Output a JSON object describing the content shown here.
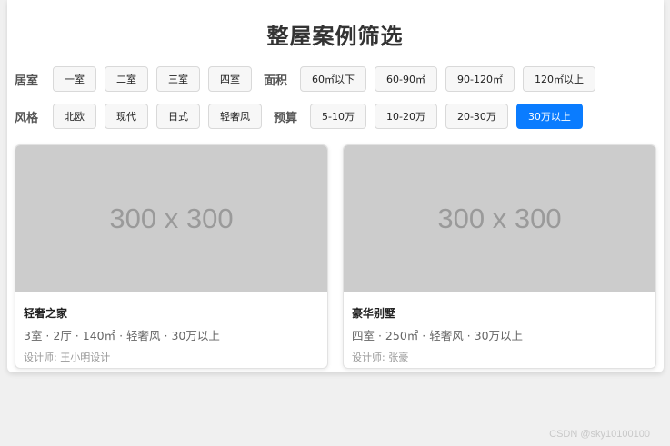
{
  "page": {
    "title": "整屋案例筛选"
  },
  "filters": {
    "layout": {
      "label": "居室",
      "options": [
        "一室",
        "二室",
        "三室",
        "四室"
      ]
    },
    "area": {
      "label": "面积",
      "options": [
        "60㎡以下",
        "60-90㎡",
        "90-120㎡",
        "120㎡以上"
      ]
    },
    "style": {
      "label": "风格",
      "options": [
        "北欧",
        "现代",
        "日式",
        "轻奢风"
      ]
    },
    "budget": {
      "label": "预算",
      "options": [
        "5-10万",
        "10-20万",
        "20-30万",
        "30万以上"
      ],
      "selected": "30万以上"
    }
  },
  "cases": [
    {
      "image_placeholder": "300 x 300",
      "title": "轻奢之家",
      "meta": "3室 · 2厅 · 140㎡ · 轻奢风 · 30万以上",
      "designer": "设计师: 王小明设计"
    },
    {
      "image_placeholder": "300 x 300",
      "title": "豪华别墅",
      "meta": "四室 · 250㎡ · 轻奢风 · 30万以上",
      "designer": "设计师: 张豪"
    }
  ],
  "watermark": "CSDN @sky10100100",
  "colors": {
    "accent": "#0a7cff",
    "placeholder_bg": "#cccccc",
    "page_bg": "#f0f0f0"
  }
}
